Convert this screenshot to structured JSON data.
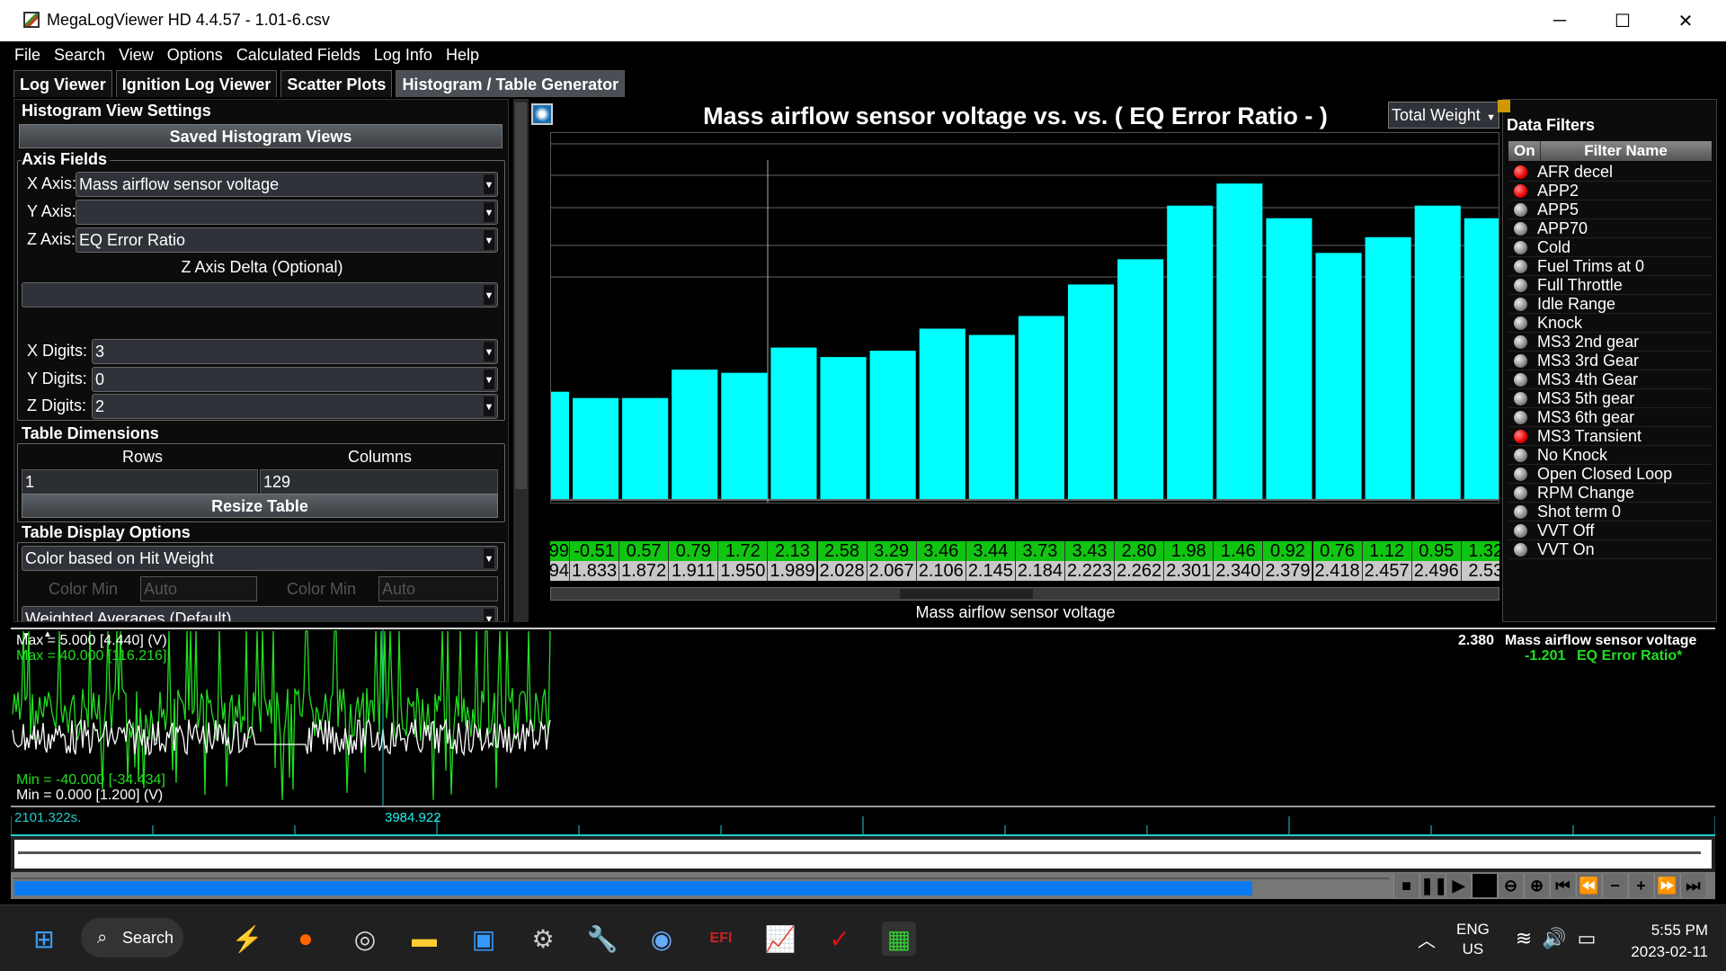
{
  "window": {
    "title": "MegaLogViewer HD 4.4.57 - 1.01-6.csv",
    "minimize": "─",
    "maximize": "☐",
    "close": "✕"
  },
  "menu": [
    "File",
    "Search",
    "View",
    "Options",
    "Calculated Fields",
    "Log Info",
    "Help"
  ],
  "tabs": [
    {
      "label": "Log Viewer",
      "active": false
    },
    {
      "label": "Ignition Log Viewer",
      "active": false
    },
    {
      "label": "Scatter Plots",
      "active": false
    },
    {
      "label": "Histogram / Table Generator",
      "active": true
    }
  ],
  "settings": {
    "heading": "Histogram View Settings",
    "saved_views": "Saved Histogram Views",
    "axis_fields": "Axis Fields",
    "x_axis_label": "X Axis:",
    "x_axis": "Mass airflow sensor voltage",
    "y_axis_label": "Y Axis:",
    "y_axis": "",
    "z_axis_label": "Z Axis:",
    "z_axis": "EQ Error Ratio",
    "z_delta_label": "Z Axis Delta (Optional)",
    "z_delta": "",
    "x_digits_label": "X Digits:",
    "x_digits": "3",
    "y_digits_label": "Y Digits:",
    "y_digits": "0",
    "z_digits_label": "Z Digits:",
    "z_digits": "2",
    "table_dimensions": "Table Dimensions",
    "rows_label": "Rows",
    "rows": "1",
    "columns_label": "Columns",
    "columns": "129",
    "resize": "Resize Table",
    "display_options": "Table Display Options",
    "color_mode": "Color based on Hit Weight",
    "color_min_label": "Color Min",
    "color_min": "Auto",
    "color_max_label": "Color Min",
    "color_max": "Auto",
    "averaging": "Weighted Averages (Default)"
  },
  "chart": {
    "title": "Mass airflow sensor voltage vs.   vs. ( EQ Error Ratio -   )",
    "weight_select": "Total Weight",
    "xlabel": "Mass airflow sensor voltage",
    "bar_color": "#00ffff"
  },
  "chart_data": {
    "type": "bar",
    "title": "Mass airflow sensor voltage vs.   vs. ( EQ Error Ratio -   )",
    "xlabel": "Mass airflow sensor voltage",
    "ylabel": "Total Weight",
    "categories": [
      "94",
      "1.833",
      "1.872",
      "1.911",
      "1.950",
      "1.989",
      "2.028",
      "2.067",
      "2.106",
      "2.145",
      "2.184",
      "2.223",
      "2.262",
      "2.301",
      "2.340",
      "2.379",
      "2.418",
      "2.457",
      "2.496",
      "2.53"
    ],
    "z_values": [
      "99",
      "-0.51",
      "0.57",
      "0.79",
      "1.72",
      "2.13",
      "2.58",
      "3.29",
      "3.46",
      "3.44",
      "3.73",
      "3.43",
      "2.80",
      "1.98",
      "1.46",
      "0.92",
      "0.76",
      "1.12",
      "0.95",
      "1.32"
    ],
    "values": [
      0.34,
      0.32,
      0.32,
      0.41,
      0.4,
      0.48,
      0.45,
      0.47,
      0.54,
      0.52,
      0.58,
      0.68,
      0.76,
      0.93,
      1.0,
      0.89,
      0.78,
      0.83,
      0.93,
      0.89
    ],
    "ylim": [
      0,
      1.16
    ],
    "grid": true
  },
  "filters": {
    "heading": "Data Filters",
    "col_on": "On",
    "col_name": "Filter Name",
    "items": [
      {
        "name": "AFR decel",
        "on": true
      },
      {
        "name": "APP2",
        "on": true
      },
      {
        "name": "APP5",
        "on": false
      },
      {
        "name": "APP70",
        "on": false
      },
      {
        "name": "Cold",
        "on": false
      },
      {
        "name": "Fuel Trims at 0",
        "on": false
      },
      {
        "name": "Full Throttle",
        "on": false
      },
      {
        "name": "Idle Range",
        "on": false
      },
      {
        "name": "Knock",
        "on": false
      },
      {
        "name": "MS3 2nd gear",
        "on": false
      },
      {
        "name": "MS3 3rd Gear",
        "on": false
      },
      {
        "name": "MS3 4th Gear",
        "on": false
      },
      {
        "name": "MS3 5th gear",
        "on": false
      },
      {
        "name": "MS3 6th gear",
        "on": false
      },
      {
        "name": "MS3 Transient",
        "on": true
      },
      {
        "name": "No Knock",
        "on": false
      },
      {
        "name": "Open Closed Loop",
        "on": false
      },
      {
        "name": "RPM Change",
        "on": false
      },
      {
        "name": "Shot term 0",
        "on": false
      },
      {
        "name": "VVT Off",
        "on": false
      },
      {
        "name": "VVT On",
        "on": false
      }
    ]
  },
  "log": {
    "max_white": "Max = 5.000 [4.440] (V)",
    "max_green": "Max = 40.000 [116.216]",
    "min_green": "Min = -40.000 [-34.434]",
    "min_white": "Min = 0.000 [1.200] (V)",
    "cursor_value_1": "2.380",
    "cursor_field_1": "Mass airflow sensor voltage",
    "cursor_value_2": "-1.201",
    "cursor_field_2": "EQ Error Ratio*",
    "start_time": "2101.322s.",
    "cursor_time": "3984.922",
    "progress": 0.72,
    "white_color": "#ffffff",
    "green_color": "#22dd22"
  },
  "taskbar": {
    "search": "Search",
    "lang1": "ENG",
    "lang2": "US",
    "time": "5:55 PM",
    "date": "2023-02-11"
  }
}
